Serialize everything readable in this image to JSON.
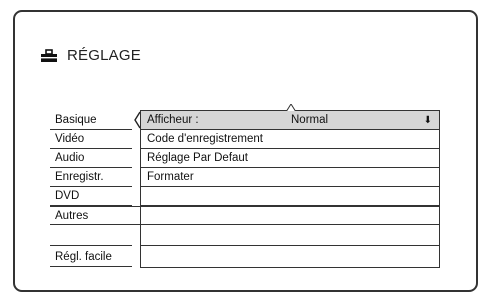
{
  "header": {
    "title": "RÉGLAGE",
    "icon": "toolbox-icon"
  },
  "categories": [
    {
      "label": "Basique"
    },
    {
      "label": "Vidéo"
    },
    {
      "label": "Audio"
    },
    {
      "label": "Enregistr."
    },
    {
      "label": "DVD"
    },
    {
      "label": "Autres"
    },
    {
      "label": ""
    },
    {
      "label": "Régl. facile"
    }
  ],
  "options": [
    {
      "label": "Afficheur :",
      "value": "Normal",
      "icon": "arrow-down-icon"
    },
    {
      "label": "Code d'enregistrement"
    },
    {
      "label": "Réglage Par Defaut"
    },
    {
      "label": "Formater"
    }
  ],
  "colors": {
    "selected_row": "#d6d6d6",
    "border": "#333333"
  }
}
